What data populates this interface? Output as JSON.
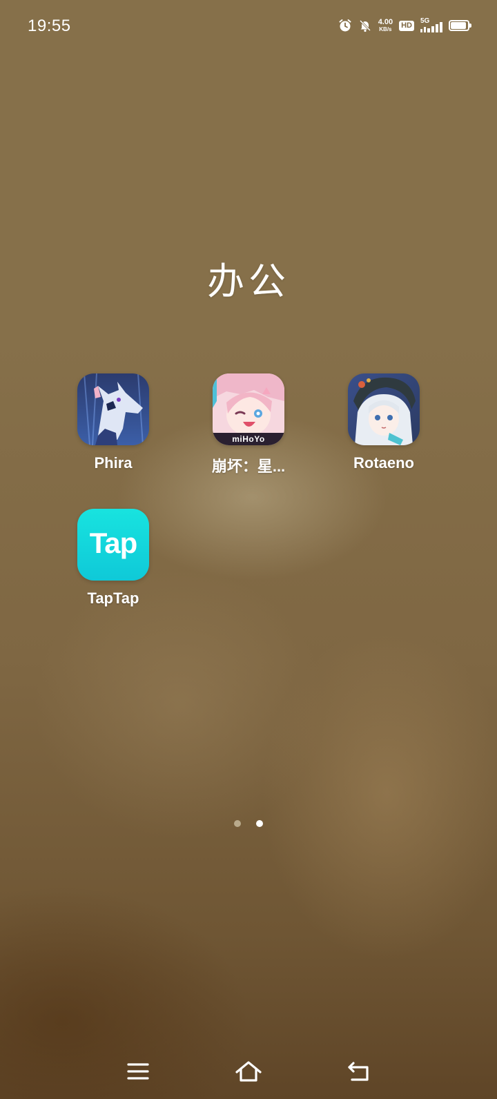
{
  "status_bar": {
    "time": "19:55",
    "net_speed_value": "4.00",
    "net_speed_unit": "KB/s",
    "hd_label": "HD",
    "network_gen": "5G",
    "battery_level": 0.9,
    "icons": [
      "alarm-icon",
      "bell-muted-icon",
      "signal-icon",
      "battery-icon"
    ]
  },
  "folder": {
    "title": "办公",
    "apps": [
      {
        "label": "Phira",
        "icon": "phira-app-icon"
      },
      {
        "label": "崩坏：星...",
        "icon": "honkai-star-rail-app-icon",
        "brand_text": "miHoYo"
      },
      {
        "label": "Rotaeno",
        "icon": "rotaeno-app-icon"
      },
      {
        "label": "TapTap",
        "icon": "taptap-app-icon",
        "brand_text": "Tap"
      }
    ]
  },
  "page_indicator": {
    "total": 2,
    "current": 2
  },
  "nav_bar": {
    "buttons": [
      {
        "name": "menu-button",
        "icon": "menu-icon"
      },
      {
        "name": "home-button",
        "icon": "home-icon"
      },
      {
        "name": "back-button",
        "icon": "back-icon"
      }
    ]
  },
  "colors": {
    "accent_taptap": "#14d9dc",
    "dot_active": "#ffffff",
    "dot_inactive": "#b9aa8c"
  }
}
